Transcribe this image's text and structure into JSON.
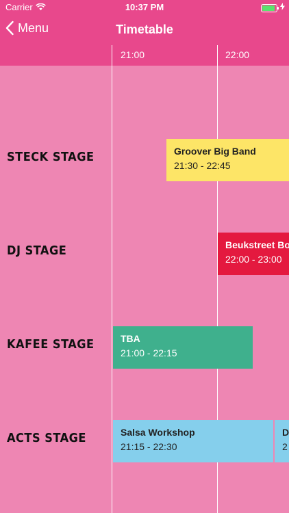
{
  "status": {
    "carrier": "Carrier",
    "time": "10:37 PM"
  },
  "nav": {
    "back_label": "Menu",
    "title": "Timetable"
  },
  "timeline": {
    "hours": [
      "21:00",
      "22:00"
    ]
  },
  "stages": [
    {
      "name": "STECK STAGE"
    },
    {
      "name": "DJ STAGE"
    },
    {
      "name": "KAFEE STAGE"
    },
    {
      "name": "ACTS STAGE"
    }
  ],
  "events": [
    {
      "stage": "STECK STAGE",
      "name": "Groover Big Band",
      "time": "21:30 - 22:45",
      "color": "#fde567"
    },
    {
      "stage": "DJ STAGE",
      "name": "Beukstreet Bo",
      "time": "22:00 - 23:00",
      "color": "#e4193f"
    },
    {
      "stage": "KAFEE STAGE",
      "name": "TBA",
      "time": "21:00 - 22:15",
      "color": "#3fb08d"
    },
    {
      "stage": "ACTS STAGE",
      "name": "Salsa Workshop",
      "time": "21:15 - 22:30",
      "color": "#85cfec"
    },
    {
      "stage": "ACTS STAGE",
      "name": "D",
      "time": "2",
      "color": "#85cfec"
    }
  ],
  "colors": {
    "header": "#e8488c",
    "background": "#ee86b3"
  }
}
